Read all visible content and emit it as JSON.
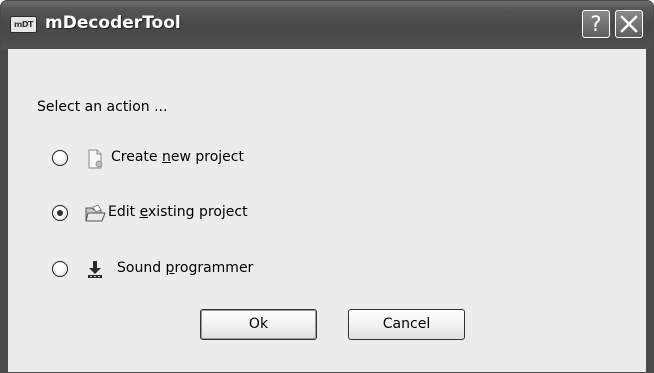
{
  "window": {
    "title": "mDecoderTool",
    "app_icon_text": "mDT",
    "help_label": "?"
  },
  "dialog": {
    "prompt": "Select an action ...",
    "options": [
      {
        "pre": "Create ",
        "mnemonic": "n",
        "post": "ew project",
        "icon": "new-file-icon",
        "selected": false
      },
      {
        "pre": "Edit ",
        "mnemonic": "e",
        "post": "xisting project",
        "icon": "open-folder-icon",
        "selected": true
      },
      {
        "pre": "Sound ",
        "mnemonic": "p",
        "post": "rogrammer",
        "icon": "download-icon",
        "selected": false
      }
    ],
    "ok_label": "Ok",
    "cancel_label": "Cancel"
  },
  "colors": {
    "titlebar": "#4f4f4f",
    "client": "#ececec"
  }
}
